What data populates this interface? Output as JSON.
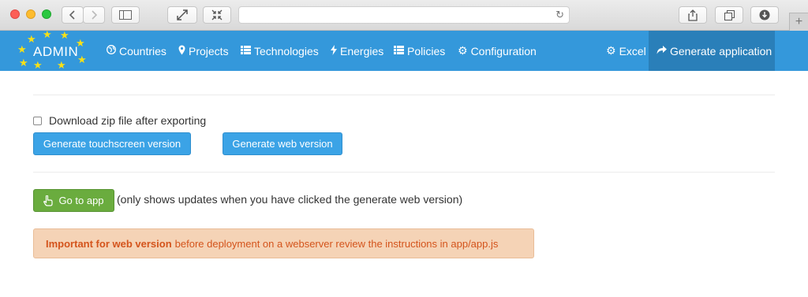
{
  "browser": {
    "icons": {
      "back": "chevron-left-icon",
      "forward": "chevron-right-icon",
      "sidebar": "sidebar-icon",
      "expand": "expand-icon",
      "collapse": "collapse-icon",
      "reload": "reload-icon",
      "share": "share-icon",
      "tabs": "tabs-icon",
      "download": "download-icon",
      "new_tab": "plus-icon"
    },
    "url": ""
  },
  "navbar": {
    "brand": "ADMIN",
    "items": [
      {
        "label": "Countries",
        "icon": "globe-icon"
      },
      {
        "label": "Projects",
        "icon": "map-marker-icon"
      },
      {
        "label": "Technologies",
        "icon": "list-icon"
      },
      {
        "label": "Energies",
        "icon": "bolt-icon"
      },
      {
        "label": "Policies",
        "icon": "list-icon"
      },
      {
        "label": "Configuration",
        "icon": "gear-icon"
      }
    ],
    "right": [
      {
        "label": "Excel",
        "icon": "gear-icon"
      },
      {
        "label": "Generate application",
        "icon": "share-arrow-icon",
        "active": true
      }
    ],
    "color": "#3498db",
    "active_color": "#2a7fb9"
  },
  "main": {
    "download_zip_label": "Download zip file after exporting",
    "download_zip_checked": false,
    "touchscreen_button": "Generate touchscreen version",
    "web_button": "Generate web version",
    "goto_button": "Go to app",
    "goto_icon": "hand-pointer-icon",
    "goto_note": "(only shows updates when you have clicked the generate web version)",
    "alert_strong": "Important for web version",
    "alert_text": "before deployment on a webserver review the instructions in app/app.js"
  }
}
